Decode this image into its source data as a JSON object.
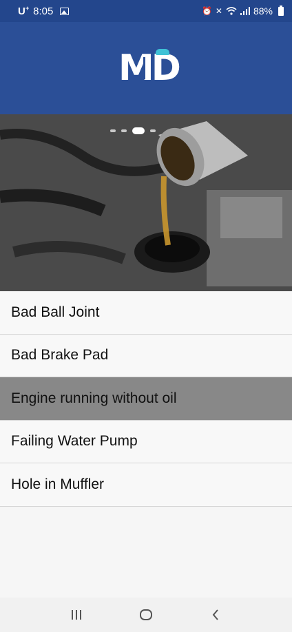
{
  "status_bar": {
    "carrier": "U",
    "carrier_sup": "+",
    "time": "8:05",
    "battery": "88%"
  },
  "header": {
    "logo_text": "MD"
  },
  "banner": {
    "slides_count": 4,
    "active_slide": 3
  },
  "list": {
    "items": [
      {
        "label": "Bad Ball Joint"
      },
      {
        "label": "Bad Brake Pad"
      },
      {
        "label": "Engine running without oil"
      },
      {
        "label": "Failing Water Pump"
      },
      {
        "label": "Hole in Muffler"
      }
    ],
    "selected_index": 2
  },
  "nav": {
    "recent_icon": "recent-apps-icon",
    "home_icon": "home-icon",
    "back_icon": "back-icon"
  },
  "colors": {
    "header": "#2b4f97",
    "status_bar": "#23468c",
    "selected_row": "#888888"
  }
}
